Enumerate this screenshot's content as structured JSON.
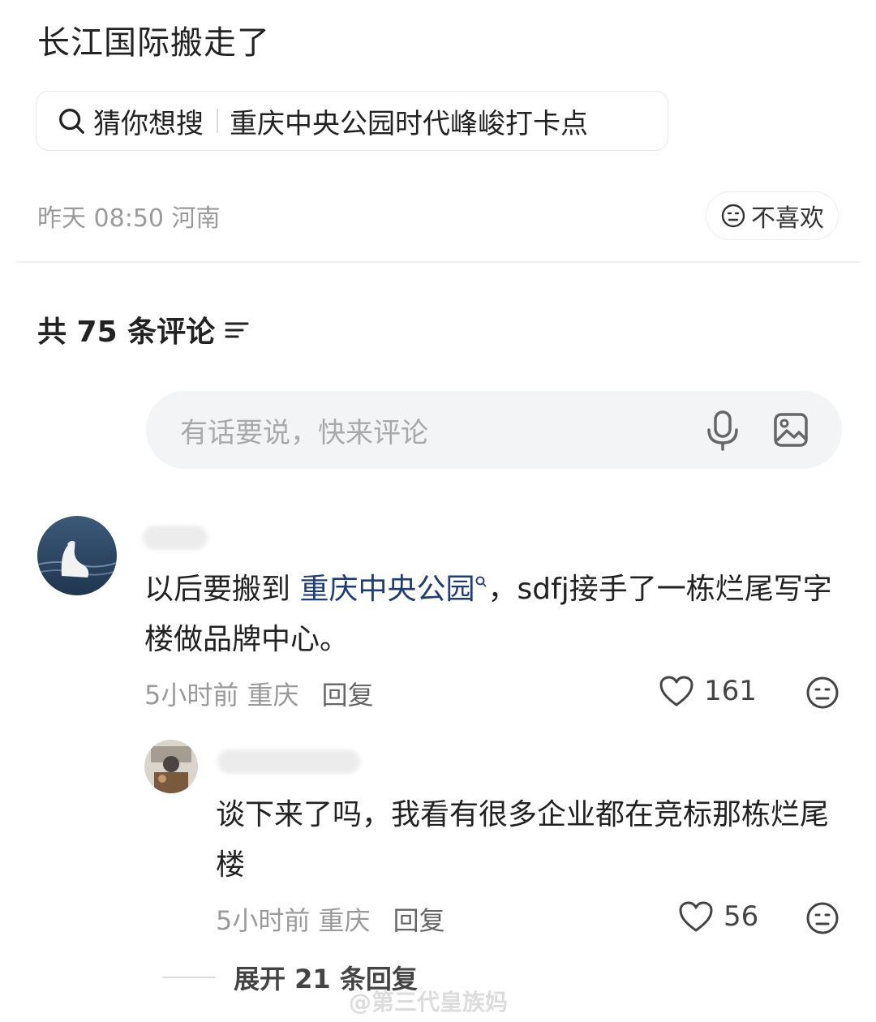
{
  "post": {
    "title": "长江国际搬走了",
    "suggest_label": "猜你想搜",
    "suggest_query": "重庆中央公园时代峰峻打卡点",
    "meta": "昨天 08:50 河南",
    "dislike_label": "不喜欢"
  },
  "comments_header": {
    "count_label": "共 75 条评论",
    "input_placeholder": "有话要说，快来评论"
  },
  "comments": [
    {
      "text_before": "以后要搬到 ",
      "link_text": "重庆中央公园",
      "text_after": "，sdfj接手了一栋烂尾写字楼做品牌中心。",
      "time": "5小时前",
      "location": "重庆",
      "reply_label": "回复",
      "likes": "161"
    },
    {
      "text": "谈下来了吗，我看有很多企业都在竞标那栋烂尾楼",
      "time": "5小时前",
      "location": "重庆",
      "reply_label": "回复",
      "likes": "56"
    }
  ],
  "expand_label": "展开 21 条回复",
  "watermark": "@第三代皇族妈",
  "icons": [
    "search-icon",
    "meh-face-icon",
    "sort-icon",
    "microphone-icon",
    "image-icon",
    "heart-icon"
  ]
}
